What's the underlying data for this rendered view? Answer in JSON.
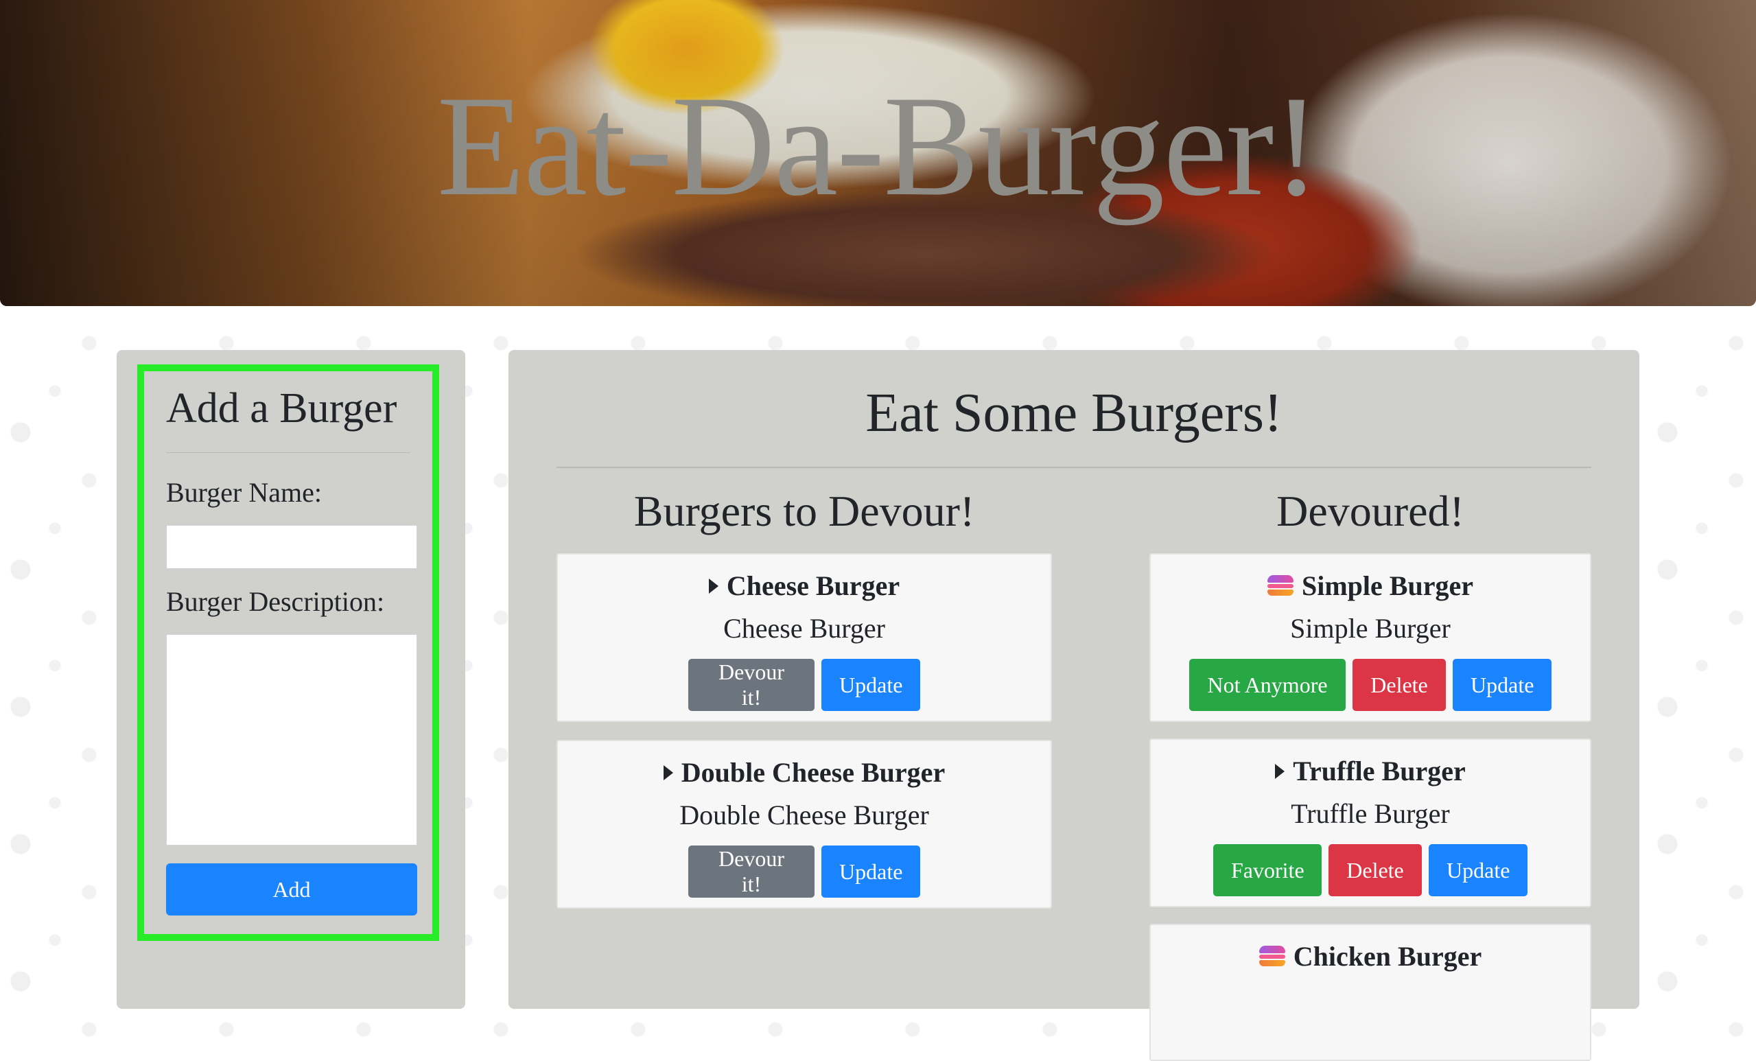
{
  "header": {
    "title": "Eat-Da-Burger!"
  },
  "add_form": {
    "title": "Add a Burger",
    "name_label": "Burger Name:",
    "name_value": "",
    "description_label": "Burger Description:",
    "description_value": "",
    "add_button": "Add"
  },
  "main": {
    "title": "Eat Some Burgers!",
    "to_devour_title": "Burgers to Devour!",
    "devoured_title": "Devoured!",
    "to_devour": [
      {
        "name": "Cheese Burger",
        "description": "Cheese Burger",
        "icon": "caret-right-icon",
        "buttons": [
          "Devour it!",
          "Update"
        ]
      },
      {
        "name": "Double Cheese Burger",
        "description": "Double Cheese Burger",
        "icon": "caret-right-icon",
        "buttons": [
          "Devour it!",
          "Update"
        ]
      }
    ],
    "devoured": [
      {
        "name": "Simple Burger",
        "description": "Simple Burger",
        "icon": "burger-emoji-icon",
        "buttons": [
          "Not Anymore",
          "Delete",
          "Update"
        ]
      },
      {
        "name": "Truffle Burger",
        "description": "Truffle Burger",
        "icon": "caret-right-icon",
        "buttons": [
          "Favorite",
          "Delete",
          "Update"
        ]
      },
      {
        "name": "Chicken Burger",
        "icon": "burger-emoji-icon"
      }
    ]
  },
  "colors": {
    "primary": "#1a84ff",
    "secondary": "#6c757d",
    "success": "#28a745",
    "danger": "#dc3545",
    "highlight_frame": "#27ec27",
    "panel": "#d0d0cc"
  }
}
